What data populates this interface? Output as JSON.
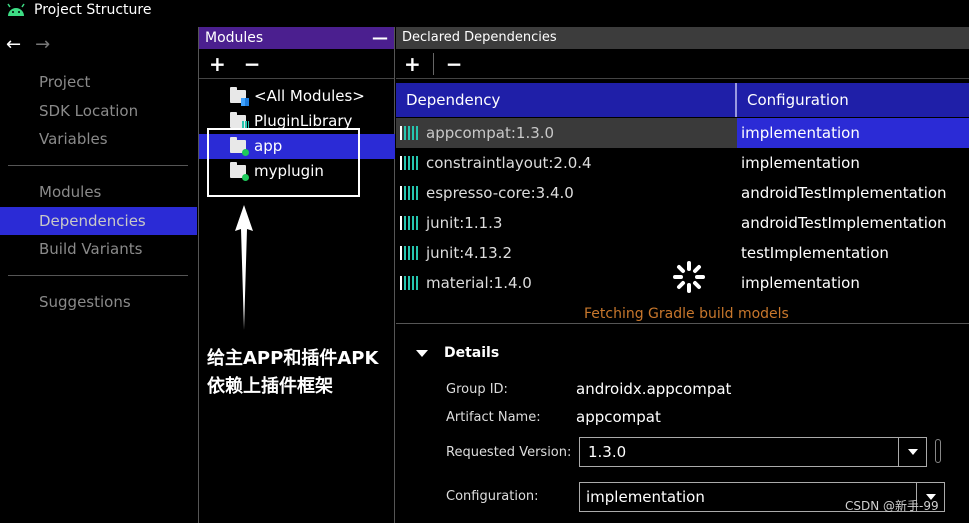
{
  "window": {
    "title": "Project Structure"
  },
  "nav": {
    "items": [
      {
        "label": "Project"
      },
      {
        "label": "SDK Location"
      },
      {
        "label": "Variables"
      },
      {
        "label": "Modules"
      },
      {
        "label": "Dependencies"
      },
      {
        "label": "Build Variants"
      },
      {
        "label": "Suggestions"
      }
    ],
    "active": "Dependencies"
  },
  "modules": {
    "title": "Modules",
    "collapse_label": "—",
    "add_label": "+",
    "remove_label": "−",
    "items": [
      {
        "label": "<All Modules>"
      },
      {
        "label": "PluginLibrary"
      },
      {
        "label": "app"
      },
      {
        "label": "myplugin"
      }
    ],
    "selected": "app"
  },
  "annotation": {
    "text": "给主APP和插件APK依赖上插件框架"
  },
  "deps": {
    "title": "Declared Dependencies",
    "add_label": "+",
    "remove_label": "−",
    "columns": [
      "Dependency",
      "Configuration"
    ],
    "rows": [
      {
        "dependency": "appcompat:1.3.0",
        "configuration": "implementation"
      },
      {
        "dependency": "constraintlayout:2.0.4",
        "configuration": "implementation"
      },
      {
        "dependency": "espresso-core:3.4.0",
        "configuration": "androidTestImplementation"
      },
      {
        "dependency": "junit:1.1.3",
        "configuration": "androidTestImplementation"
      },
      {
        "dependency": "junit:4.13.2",
        "configuration": "testImplementation"
      },
      {
        "dependency": "material:1.4.0",
        "configuration": "implementation"
      }
    ],
    "status": "Fetching Gradle build models"
  },
  "details": {
    "title": "Details",
    "group_id_label": "Group ID:",
    "group_id": "androidx.appcompat",
    "artifact_label": "Artifact Name:",
    "artifact": "appcompat",
    "requested_version_label": "Requested Version:",
    "requested_version": "1.3.0",
    "configuration_label": "Configuration:",
    "configuration": "implementation"
  },
  "watermark": "CSDN @新手-99",
  "colors": {
    "selection": "#2b2bd6",
    "modules_header": "#4b1f8f",
    "status": "#c8772c"
  }
}
